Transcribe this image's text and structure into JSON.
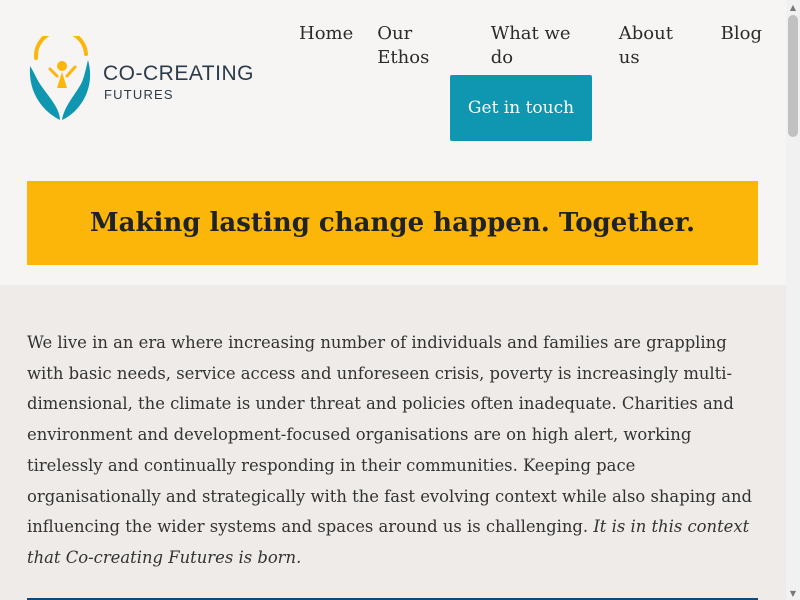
{
  "brand": {
    "name": "CO-CREATING",
    "subtitle": "FUTURES"
  },
  "nav": {
    "items": [
      "Home",
      "Our Ethos",
      "What we do",
      "About us",
      "Blog"
    ]
  },
  "cta": {
    "label": "Get in touch",
    "color": "#0f96b0"
  },
  "banner": {
    "text": "Making lasting change happen. Together.",
    "color": "#fcb609"
  },
  "intro": {
    "text": "We live in an era where increasing number of individuals and families are grappling with basic needs, service access and unforeseen crisis, poverty is increasingly multi-dimensional, the climate is under threat and policies often inadequate. Charities and environment and development-focused organisations are on high alert, working tirelessly and continually responding in their communities. Keeping pace organisationally and strategically with the fast evolving context while also shaping and influencing the wider systems and spaces around us is challenging. ",
    "emphasis": "It is in this context that Co-creating Futures is born."
  },
  "icons": {
    "logo": "hands-person-sun-logo-icon",
    "scroll_up": "chevron-up-icon",
    "scroll_down": "chevron-down-icon"
  }
}
